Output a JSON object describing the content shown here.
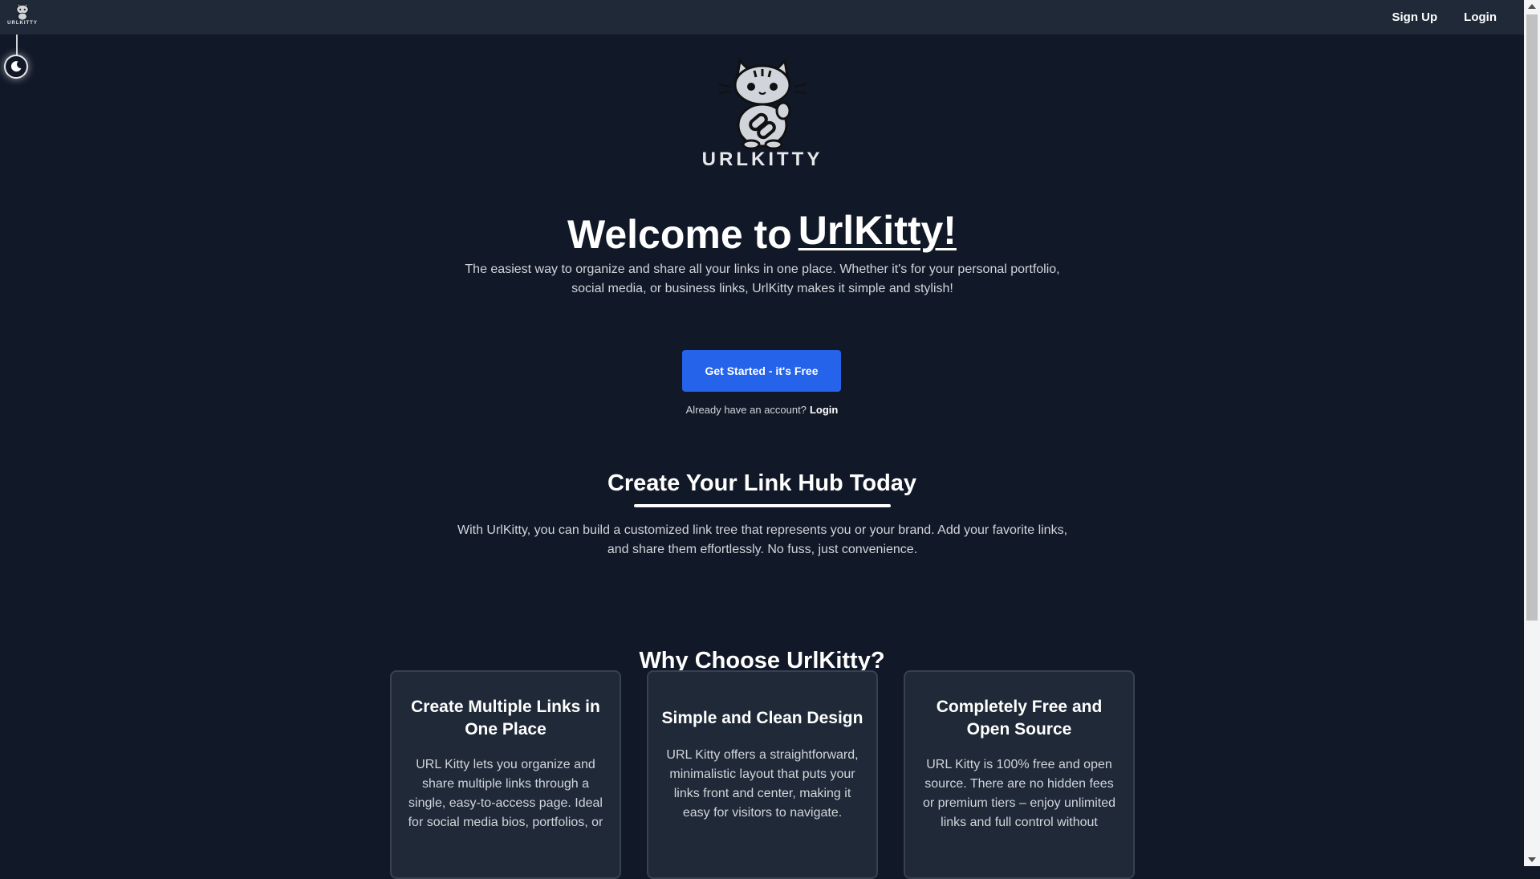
{
  "header": {
    "logo_text": "URLKITTY",
    "nav": [
      {
        "label": "Sign Up"
      },
      {
        "label": "Login"
      }
    ]
  },
  "theme_toggle": {
    "icon": "moon-icon"
  },
  "hero": {
    "logo_text": "URLKITTY",
    "welcome_prefix": "Welcome to",
    "welcome_brand": "UrlKitty!",
    "intro": "The easiest way to organize and share all your links in one place. Whether it's for your personal portfolio, social media, or business links, UrlKitty makes it simple and stylish!",
    "cta_label": "Get Started - it's Free",
    "account_prompt": "Already have an account?",
    "login_link": "Login"
  },
  "link_hub": {
    "heading": "Create Your Link Hub Today",
    "text": "With UrlKitty, you can build a customized link tree that represents you or your brand. Add your favorite links, and share them effortlessly. No fuss, just convenience."
  },
  "why": {
    "heading": "Why Choose UrlKitty?",
    "cards": [
      {
        "title": "Create Multiple Links in One Place",
        "text": "URL Kitty lets you organize and share multiple links through a single, easy-to-access page. Ideal for social media bios, portfolios, or"
      },
      {
        "title": "Simple and Clean Design",
        "text": "URL Kitty offers a straightforward, minimalistic layout that puts your links front and center, making it easy for visitors to navigate."
      },
      {
        "title": "Completely Free and Open Source",
        "text": "URL Kitty is 100% free and open source. There are no hidden fees or premium tiers – enjoy unlimited links and full control without"
      }
    ]
  },
  "colors": {
    "background": "#111827",
    "header": "#1f2937",
    "accent": "#2563eb",
    "card": "#1f2937"
  }
}
